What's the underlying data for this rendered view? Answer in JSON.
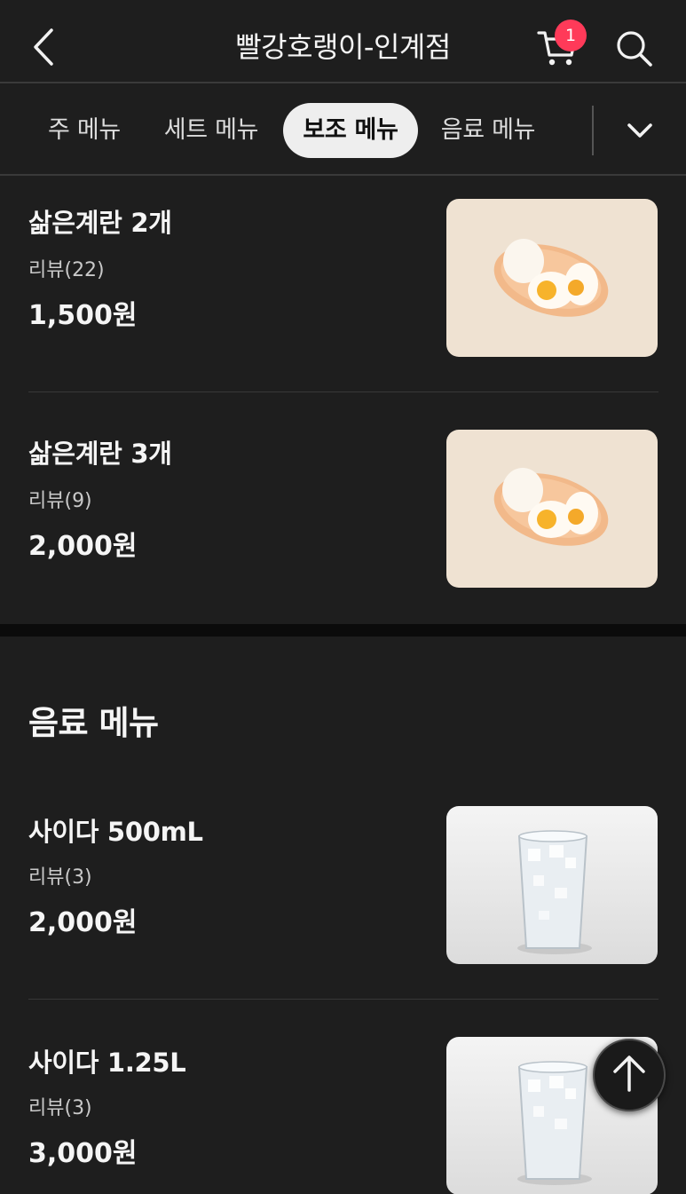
{
  "header": {
    "title": "빨강호랭이-인계점",
    "cart_count": "1",
    "icons": [
      "back-arrow-icon",
      "cart-icon",
      "search-icon"
    ]
  },
  "tabs": [
    {
      "label": "주 메뉴",
      "active": false
    },
    {
      "label": "세트 메뉴",
      "active": false
    },
    {
      "label": "보조 메뉴",
      "active": true
    },
    {
      "label": "음료 메뉴",
      "active": false
    }
  ],
  "side_menu_items": [
    {
      "name": "삶은계란 2개",
      "review": "리뷰(22)",
      "price": "1,500원",
      "image": "boiled-eggs-photo"
    },
    {
      "name": "삶은계란 3개",
      "review": "리뷰(9)",
      "price": "2,000원",
      "image": "boiled-eggs-photo"
    }
  ],
  "drink_section": {
    "title": "음료 메뉴",
    "items": [
      {
        "name": "사이다 500mL",
        "review": "리뷰(3)",
        "price": "2,000원",
        "image": "cider-glass-photo"
      },
      {
        "name": "사이다 1.25L",
        "review": "리뷰(3)",
        "price": "3,000원",
        "image": "cider-glass-photo"
      }
    ]
  },
  "colors": {
    "background": "#1e1e1e",
    "badge": "#ff3a59",
    "active_tab_bg": "#eeeeee",
    "text": "#f5f5f5"
  }
}
